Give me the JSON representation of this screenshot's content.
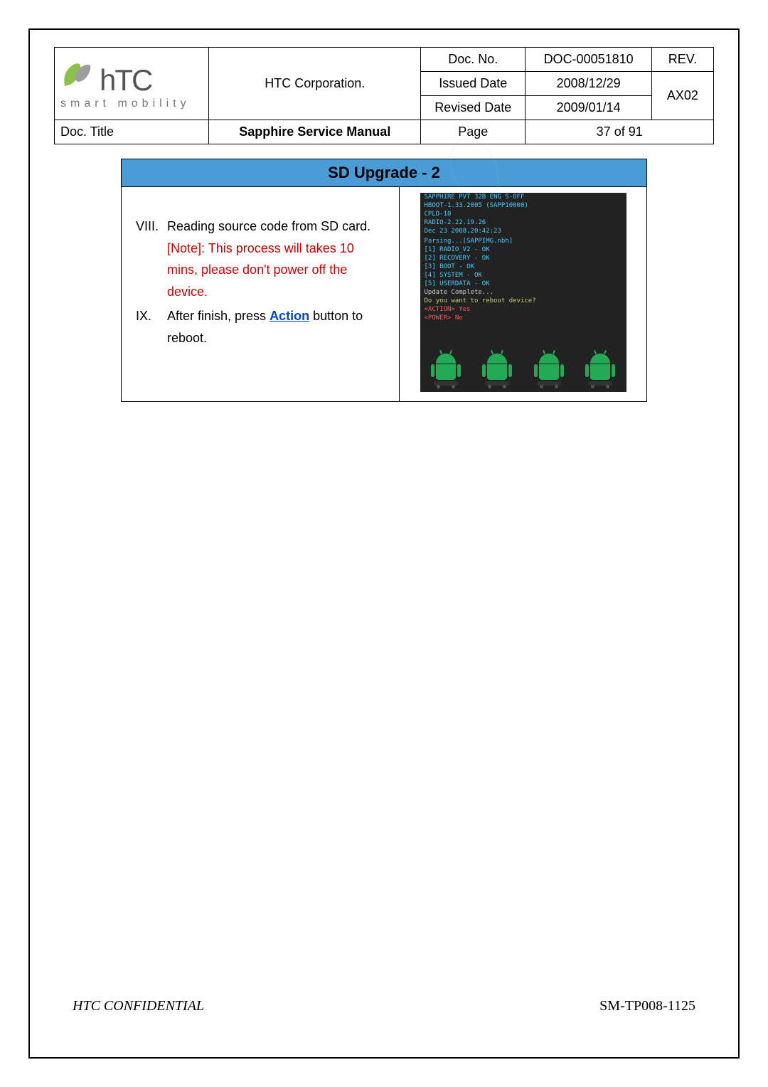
{
  "header": {
    "corp_name": "HTC Corporation.",
    "logo_text": "hTC",
    "logo_sub": "smart mobility",
    "fields": {
      "doc_no_label": "Doc. No.",
      "doc_no": "DOC-00051810",
      "rev_label": "REV.",
      "rev": "AX02",
      "issued_label": "Issued Date",
      "issued": "2008/12/29",
      "revised_label": "Revised Date",
      "revised": "2009/01/14",
      "doc_title_label": "Doc. Title",
      "doc_title": "Sapphire Service Manual",
      "page_label": "Page",
      "page": "37  of  91"
    }
  },
  "content": {
    "section_title": "SD Upgrade - 2",
    "items": [
      {
        "num": "VIII.",
        "text": "Reading source code from SD card.",
        "note": "[Note]: This process will takes 10 mins, please don't power off the device."
      },
      {
        "num": "IX.",
        "text_before": "After finish, press ",
        "action": "Action",
        "text_after": " button to reboot."
      }
    ],
    "bootlines": [
      {
        "cls": "green",
        "t": "SAPPHIRE PVT 32B ENG S-OFF"
      },
      {
        "cls": "green",
        "t": "HBOOT-1.33.2005 (SAPP10000)"
      },
      {
        "cls": "green",
        "t": "CPLD-10"
      },
      {
        "cls": "green",
        "t": "RADIO-2.22.19.26"
      },
      {
        "cls": "green",
        "t": "Dec 23 2008,20:42:23"
      },
      {
        "cls": "white",
        "t": ""
      },
      {
        "cls": "green",
        "t": "Parsing...[SAPPIMG.nbh]"
      },
      {
        "cls": "green",
        "t": "[1] RADIO_V2   - OK"
      },
      {
        "cls": "green",
        "t": "[2] RECOVERY   - OK"
      },
      {
        "cls": "green",
        "t": "[3] BOOT       - OK"
      },
      {
        "cls": "green",
        "t": "[4] SYSTEM     - OK"
      },
      {
        "cls": "green",
        "t": "[5] USERDATA   - OK"
      },
      {
        "cls": "white",
        "t": "Update Complete..."
      },
      {
        "cls": "yellow",
        "t": "Do you want to reboot device?"
      },
      {
        "cls": "red",
        "t": "<ACTION> Yes"
      },
      {
        "cls": "red",
        "t": "<POWER> No"
      }
    ]
  },
  "footer": {
    "left": "HTC CONFIDENTIAL",
    "right": "SM-TP008-1125"
  }
}
